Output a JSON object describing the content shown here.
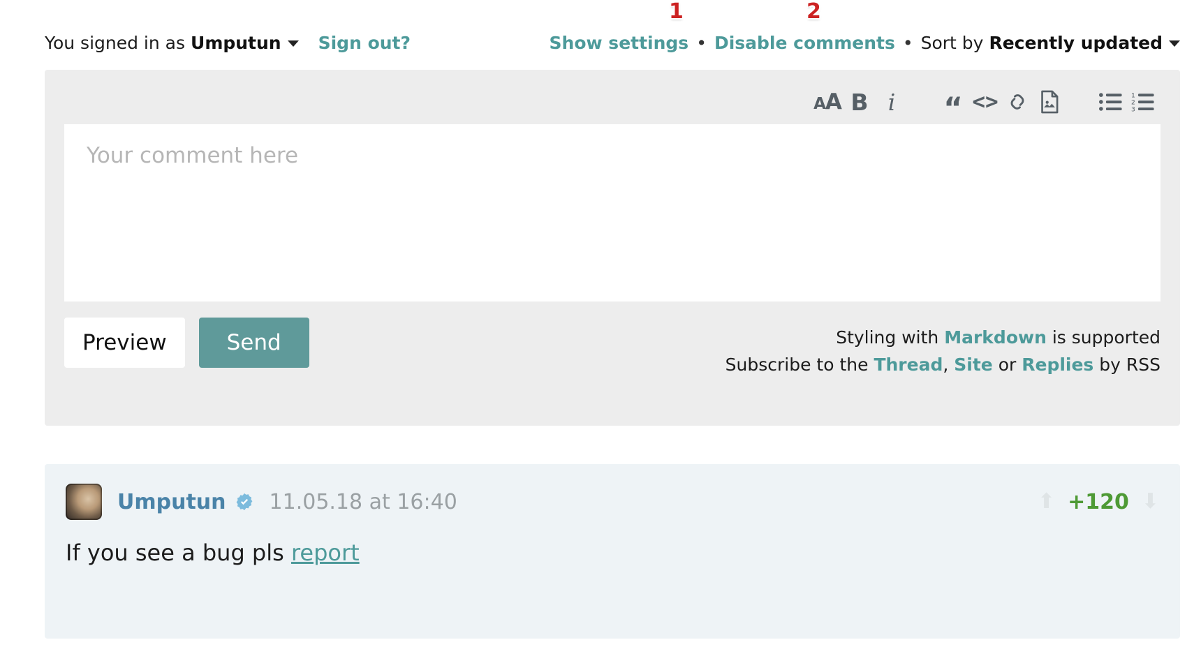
{
  "header": {
    "signed_in_prefix": "You signed in as",
    "username": "Umputun",
    "sign_out": "Sign out?",
    "show_settings": "Show settings",
    "disable_comments": "Disable comments",
    "separator": "•",
    "sort_prefix": "Sort by",
    "sort_value": "Recently updated"
  },
  "annotations": [
    {
      "label": "1",
      "target": "show-settings"
    },
    {
      "label": "2",
      "target": "disable-comments"
    }
  ],
  "editor": {
    "toolbar": [
      {
        "name": "font-size-icon",
        "glyph": "AA",
        "title": "Font size"
      },
      {
        "name": "bold-icon",
        "glyph": "B",
        "title": "Bold"
      },
      {
        "name": "italic-icon",
        "glyph": "i",
        "title": "Italic"
      },
      {
        "name": "quote-icon",
        "glyph": "“",
        "title": "Quote"
      },
      {
        "name": "code-icon",
        "glyph": "<>",
        "title": "Code"
      },
      {
        "name": "link-icon",
        "glyph": "link",
        "title": "Link"
      },
      {
        "name": "image-icon",
        "glyph": "image",
        "title": "Image"
      },
      {
        "name": "bullet-list-icon",
        "glyph": "list",
        "title": "Bulleted list"
      },
      {
        "name": "numbered-list-icon",
        "glyph": "numlist",
        "title": "Numbered list"
      }
    ],
    "placeholder": "Your comment here",
    "value": "",
    "preview_label": "Preview",
    "send_label": "Send",
    "styling_prefix": "Styling with",
    "styling_link": "Markdown",
    "styling_suffix": "is supported",
    "subscribe_prefix": "Subscribe to the",
    "subscribe_thread": "Thread",
    "subscribe_comma": ",",
    "subscribe_site": "Site",
    "subscribe_or": "or",
    "subscribe_replies": "Replies",
    "subscribe_suffix": "by RSS"
  },
  "comments": [
    {
      "author": "Umputun",
      "verified": true,
      "time": "11.05.18 at 16:40",
      "score": "+120",
      "upvote": "⬆",
      "downvote": "⬇",
      "body_prefix": "If you see a bug pls",
      "body_link": "report"
    }
  ],
  "colors": {
    "accent_teal": "#4d9a9a",
    "send_button": "#5f9a9a",
    "form_background": "#ededed",
    "comment_background": "#eef3f6",
    "score_green": "#4e9a35",
    "author_blue": "#4a83a8",
    "annotation_red": "#cc2222"
  }
}
